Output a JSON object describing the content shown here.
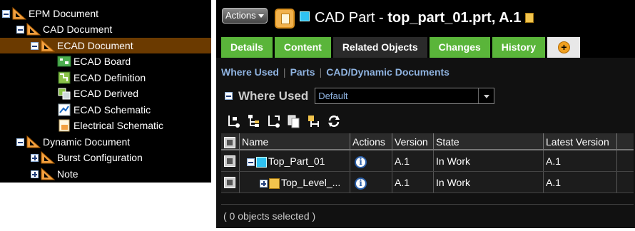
{
  "tree": {
    "nodes": [
      {
        "label": "EPM Document",
        "expand": "minus",
        "icon": "epm-document-icon"
      },
      {
        "label": "CAD Document",
        "expand": "minus",
        "icon": "cad-document-icon"
      },
      {
        "label": "ECAD Document",
        "expand": "minus",
        "icon": "ecad-document-icon",
        "selected": true
      },
      {
        "label": "ECAD Board",
        "icon": "ecad-board-icon"
      },
      {
        "label": "ECAD Definition",
        "icon": "ecad-definition-icon"
      },
      {
        "label": "ECAD Derived",
        "icon": "ecad-derived-icon"
      },
      {
        "label": "ECAD Schematic",
        "icon": "ecad-schematic-icon"
      },
      {
        "label": "Electrical Schematic",
        "icon": "electrical-schematic-icon"
      },
      {
        "label": "Dynamic Document",
        "expand": "minus",
        "icon": "dynamic-document-icon"
      },
      {
        "label": "Burst Configuration",
        "expand": "plus",
        "icon": "burst-configuration-icon"
      },
      {
        "label": "Note",
        "expand": "plus",
        "icon": "note-icon"
      }
    ]
  },
  "header": {
    "actions_label": "Actions",
    "object_type": "CAD Part - ",
    "object_name": "top_part_01.prt, A.1"
  },
  "tabs": [
    "Details",
    "Content",
    "Related Objects",
    "Changes",
    "History"
  ],
  "active_tab": "Related Objects",
  "subnav": [
    "Where Used",
    "Parts",
    "CAD/Dynamic Documents"
  ],
  "where_used": {
    "title": "Where Used",
    "view_value": "Default"
  },
  "toolbar_icons": [
    "insert-child-icon",
    "insert-tree-icon",
    "expand-icon",
    "copy-icon",
    "set-filter-icon",
    "refresh-icon"
  ],
  "table": {
    "columns": [
      "Name",
      "Actions",
      "Version",
      "State",
      "Latest Version"
    ],
    "rows": [
      {
        "name": "Top_Part_01",
        "version": "A.1",
        "state": "In Work",
        "latest": "A.1"
      },
      {
        "name": "Top_Level_...",
        "version": "A.1",
        "state": "In Work",
        "latest": "A.1"
      }
    ]
  },
  "footer_text": "( 0 objects selected )",
  "colors": {
    "tab_green": "#5ab53a",
    "link_blue": "#8fb3e0",
    "selected_row": "#6b3a00"
  }
}
